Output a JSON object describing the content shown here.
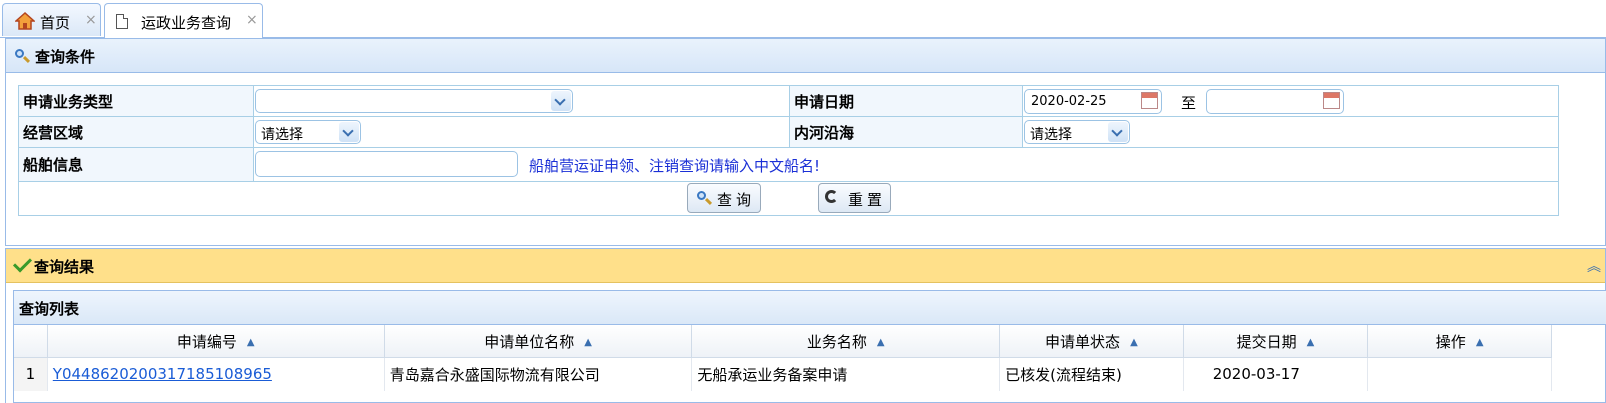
{
  "tabs": [
    {
      "label": "首页",
      "icon": "home-icon",
      "close": "×"
    },
    {
      "label": "运政业务查询",
      "icon": "document-icon",
      "close": "×"
    }
  ],
  "query_panel": {
    "title": "查询条件",
    "fields": {
      "business_type_label": "申请业务类型",
      "business_type_value": "",
      "apply_date_label": "申请日期",
      "date_from": "2020-02-25",
      "date_sep": "至",
      "date_to": "",
      "region_label": "经营区域",
      "region_value": "请选择",
      "river_sea_label": "内河沿海",
      "river_sea_value": "请选择",
      "ship_label": "船舶信息",
      "ship_value": "",
      "ship_hint": "船舶营运证申领、注销查询请输入中文船名!"
    },
    "search_button": "查询",
    "reset_button": "重置"
  },
  "result_panel": {
    "title": "查询结果",
    "list_title": "查询列表",
    "columns": [
      "申请编号",
      "申请单位名称",
      "业务名称",
      "申请单状态",
      "提交日期",
      "操作"
    ],
    "rows": [
      {
        "index": "1",
        "apply_no": "Y044862020031718510896​5",
        "company": "青岛嘉合永盛国际物流有限公司",
        "business": "无船承运业务备案申请",
        "status": "已核发(流程结束)",
        "date": "2020-03-17",
        "action": ""
      }
    ]
  },
  "colors": {
    "panel_border": "#99bbe8",
    "result_header": "#ffe08a",
    "link": "#1a5cd6",
    "hint": "#1a2fd6"
  }
}
